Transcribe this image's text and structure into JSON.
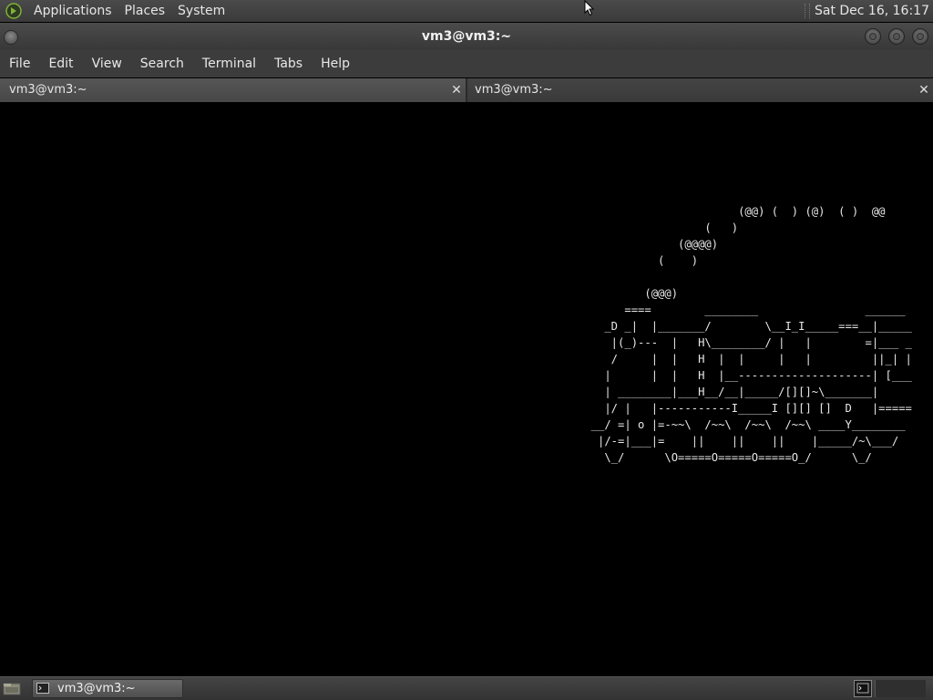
{
  "top_panel": {
    "menus": [
      "Applications",
      "Places",
      "System"
    ],
    "clock": "Sat Dec 16, 16:17"
  },
  "window": {
    "title": "vm3@vm3:~"
  },
  "menubar": {
    "items": [
      "File",
      "Edit",
      "View",
      "Search",
      "Terminal",
      "Tabs",
      "Help"
    ]
  },
  "tabs": [
    {
      "label": "vm3@vm3:~",
      "active": false
    },
    {
      "label": "vm3@vm3:~",
      "active": true
    }
  ],
  "terminal": {
    "ascii_art": "                        (@@) (  ) (@)  ( )  @@\n                   (   )\n               (@@@@)\n            (    )\n\n          (@@@)\n       ====        ________                ______\n    _D _|  |_______/        \\__I_I_____===__|_____\n     |(_)---  |   H\\________/ |   |        =|___ _\n     /     |  |   H  |  |     |   |         ||_| |\n    |      |  |   H  |__--------------------| [___\n    | ________|___H__/__|_____/[][]~\\_______|\n    |/ |   |-----------I_____I [][] []  D   |=====\n  __/ =| o |=-~~\\  /~~\\  /~~\\  /~~\\ ____Y________\n   |/-=|___|=    ||    ||    ||    |_____/~\\___/\n    \\_/      \\O=====O=====O=====O_/      \\_/"
  },
  "taskbar": {
    "task_label": "vm3@vm3:~"
  },
  "icons": {
    "logo": "gnome-foot-icon",
    "cursor": "mouse-pointer-icon",
    "show_desktop": "show-desktop-icon",
    "task": "terminal-icon"
  },
  "colors": {
    "panel_bg": "#3c3c3c",
    "terminal_bg": "#000000",
    "terminal_fg": "#e8e8e8",
    "logo_green": "#7fb23a"
  }
}
